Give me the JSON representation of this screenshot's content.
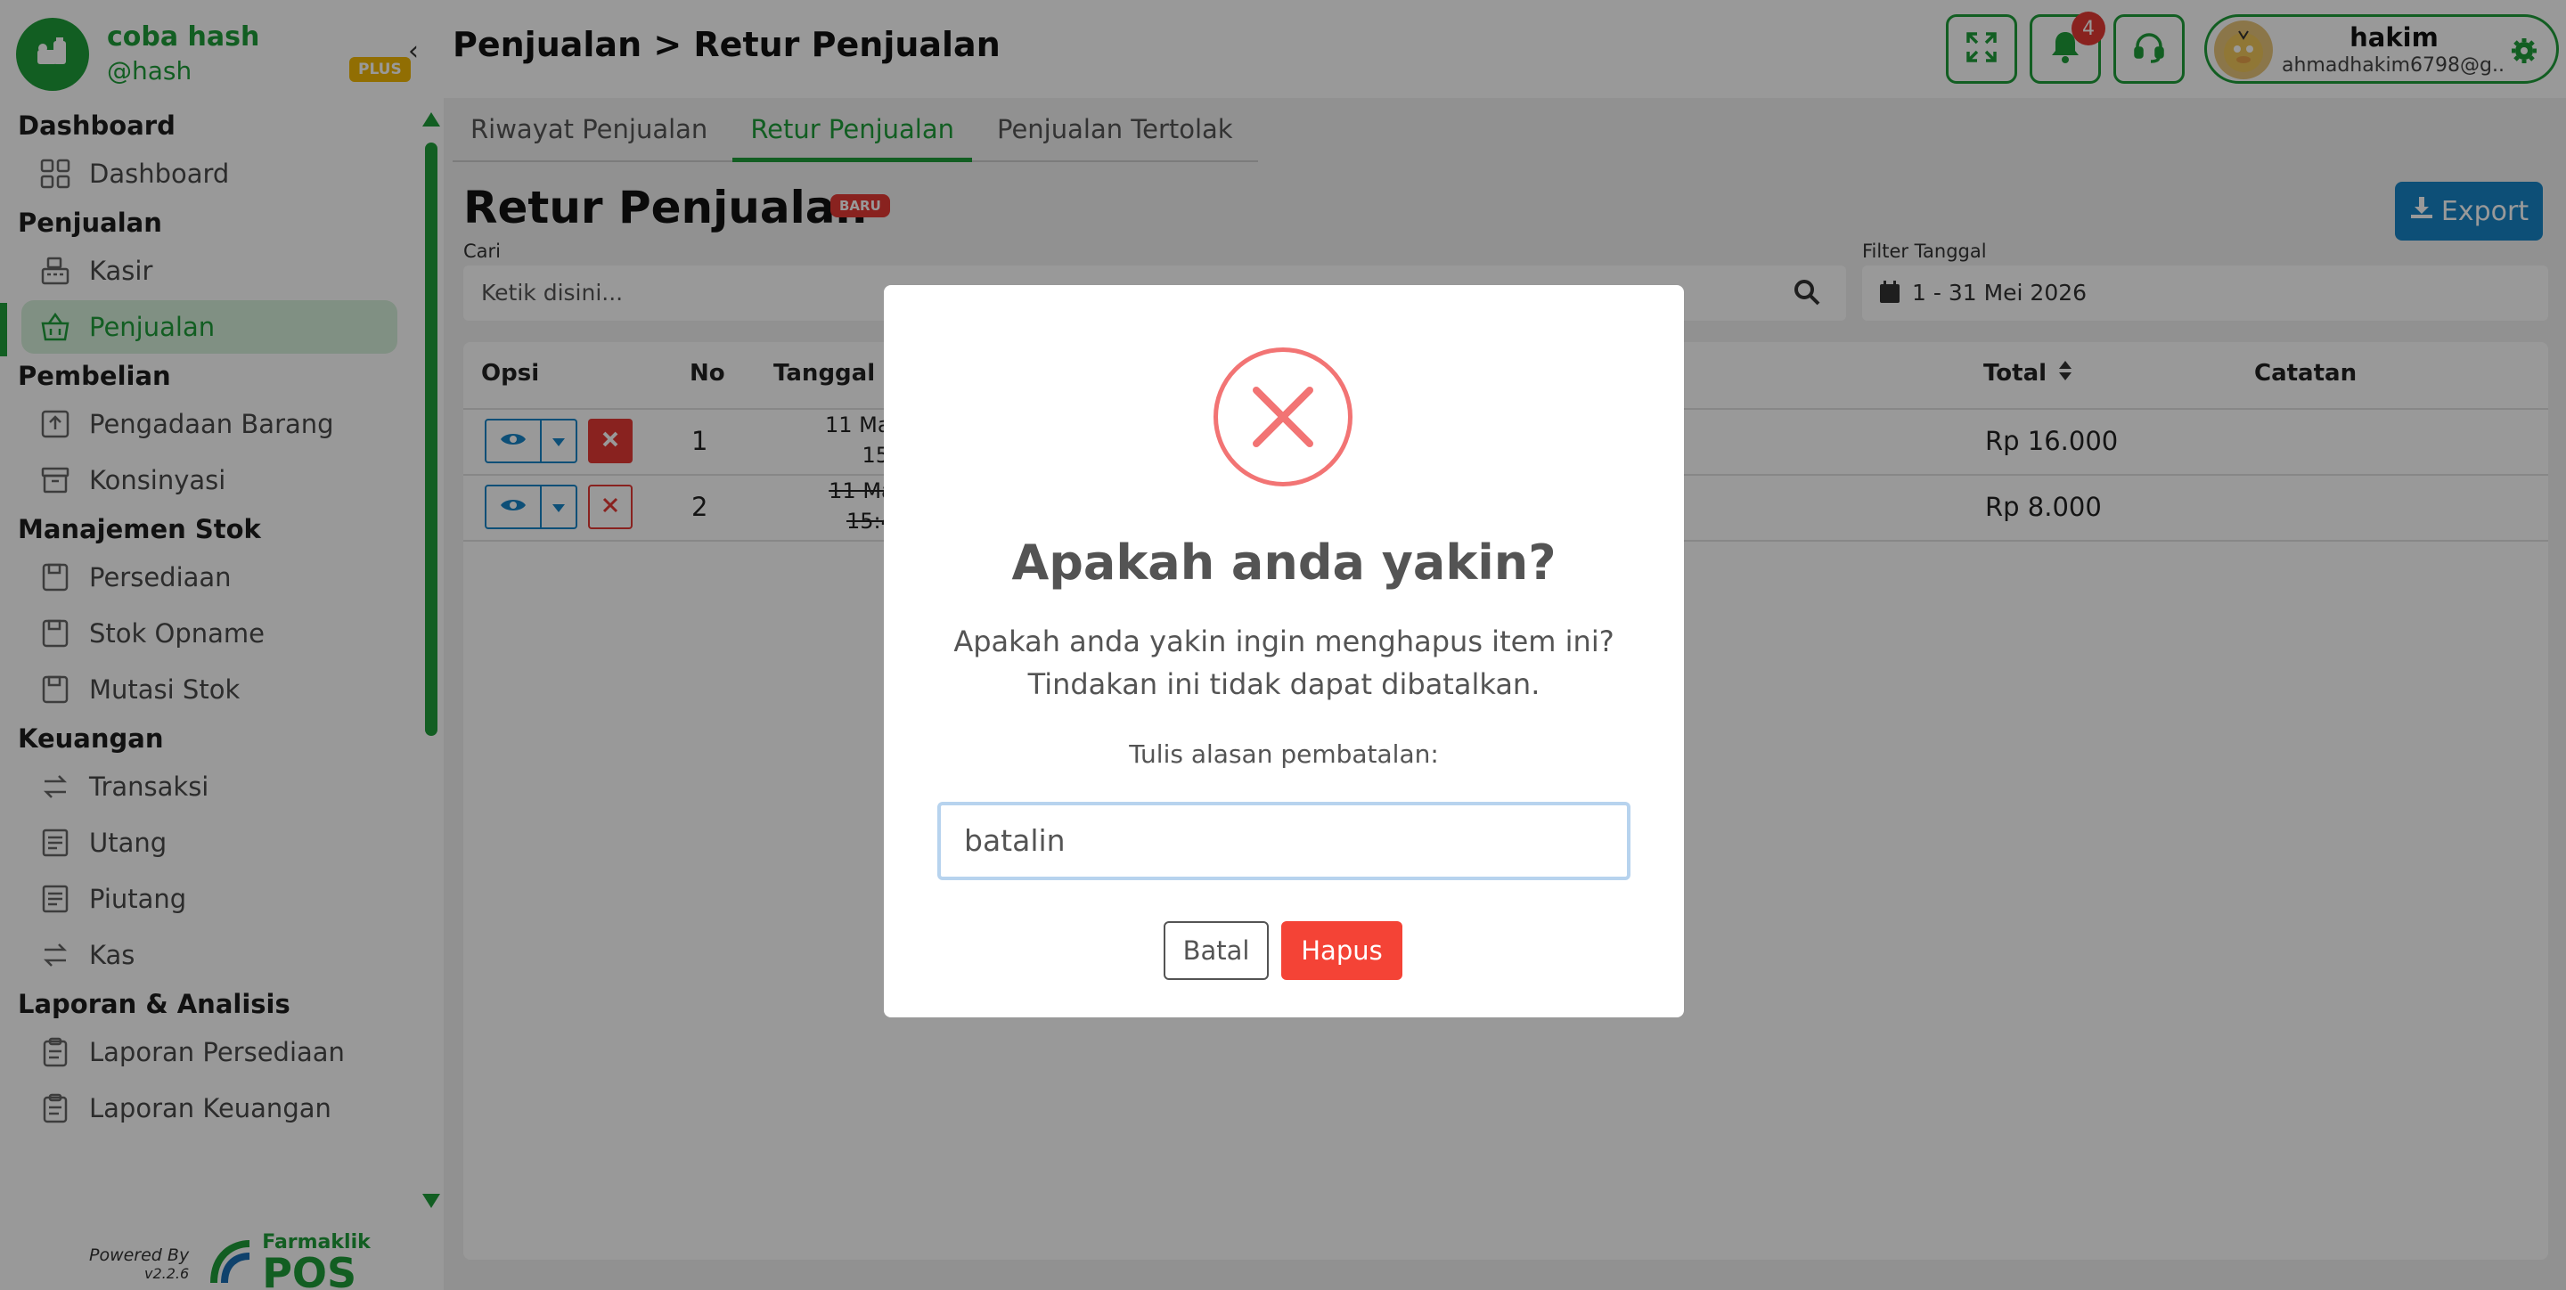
{
  "brand": {
    "name": "coba hash",
    "handle": "@hash",
    "plan_badge": "PLUS"
  },
  "sidebar": {
    "groups": [
      {
        "title": "Dashboard",
        "items": [
          {
            "label": "Dashboard",
            "icon": "grid-icon"
          }
        ]
      },
      {
        "title": "Penjualan",
        "items": [
          {
            "label": "Kasir",
            "icon": "cash-register-icon"
          },
          {
            "label": "Penjualan",
            "icon": "basket-icon",
            "active": true
          }
        ]
      },
      {
        "title": "Pembelian",
        "items": [
          {
            "label": "Pengadaan Barang",
            "icon": "upload-box-icon"
          },
          {
            "label": "Konsinyasi",
            "icon": "archive-icon"
          }
        ]
      },
      {
        "title": "Manajemen Stok",
        "items": [
          {
            "label": "Persediaan",
            "icon": "floppy-icon"
          },
          {
            "label": "Stok Opname",
            "icon": "floppy-icon"
          },
          {
            "label": "Mutasi Stok",
            "icon": "floppy-icon"
          }
        ]
      },
      {
        "title": "Keuangan",
        "items": [
          {
            "label": "Transaksi",
            "icon": "exchange-icon"
          },
          {
            "label": "Utang",
            "icon": "receipt-icon"
          },
          {
            "label": "Piutang",
            "icon": "receipt-icon"
          },
          {
            "label": "Kas",
            "icon": "exchange-icon"
          }
        ]
      },
      {
        "title": "Laporan & Analisis",
        "items": [
          {
            "label": "Laporan Persediaan",
            "icon": "clipboard-icon"
          },
          {
            "label": "Laporan Keuangan",
            "icon": "clipboard-icon"
          }
        ]
      }
    ],
    "powered_by": "Powered By",
    "version": "v2.2.6",
    "logo_top": "Farmaklik",
    "logo_bottom": "POS"
  },
  "header": {
    "title": "Penjualan > Retur Penjualan",
    "notification_count": "4",
    "user_name": "hakim",
    "user_email": "ahmadhakim6798@g..."
  },
  "tabs": [
    {
      "label": "Riwayat Penjualan",
      "active": false
    },
    {
      "label": "Retur Penjualan",
      "active": true
    },
    {
      "label": "Penjualan Tertolak",
      "active": false
    }
  ],
  "content": {
    "title": "Retur Penjualan",
    "badge": "BARU",
    "export_label": "Export",
    "search_label": "Cari",
    "search_placeholder": "Ketik disini...",
    "filter_label": "Filter Tanggal",
    "filter_value": "1 - 31 Mei 2026"
  },
  "table": {
    "columns": [
      "Opsi",
      "No",
      "Tanggal",
      "Total",
      "Catatan"
    ],
    "rows": [
      {
        "no": "1",
        "date_line1": "11 Ma",
        "date_line2": "15",
        "total": "Rp 16.000",
        "cancelled": false
      },
      {
        "no": "2",
        "date_line1": "11 Ma",
        "date_line2": "15:4",
        "total": "Rp 8.000",
        "cancelled": true
      }
    ]
  },
  "modal": {
    "title": "Apakah anda yakin?",
    "text_line1": "Apakah anda yakin ingin menghapus item ini?",
    "text_line2": "Tindakan ini tidak dapat dibatalkan.",
    "reason_label": "Tulis alasan pembatalan:",
    "reason_value": "batalin",
    "cancel_label": "Batal",
    "confirm_label": "Hapus"
  },
  "colors": {
    "primary_green": "#1f9d3a",
    "export_blue": "#1784c7",
    "danger_red": "#e53935",
    "modal_icon": "#f27474"
  }
}
